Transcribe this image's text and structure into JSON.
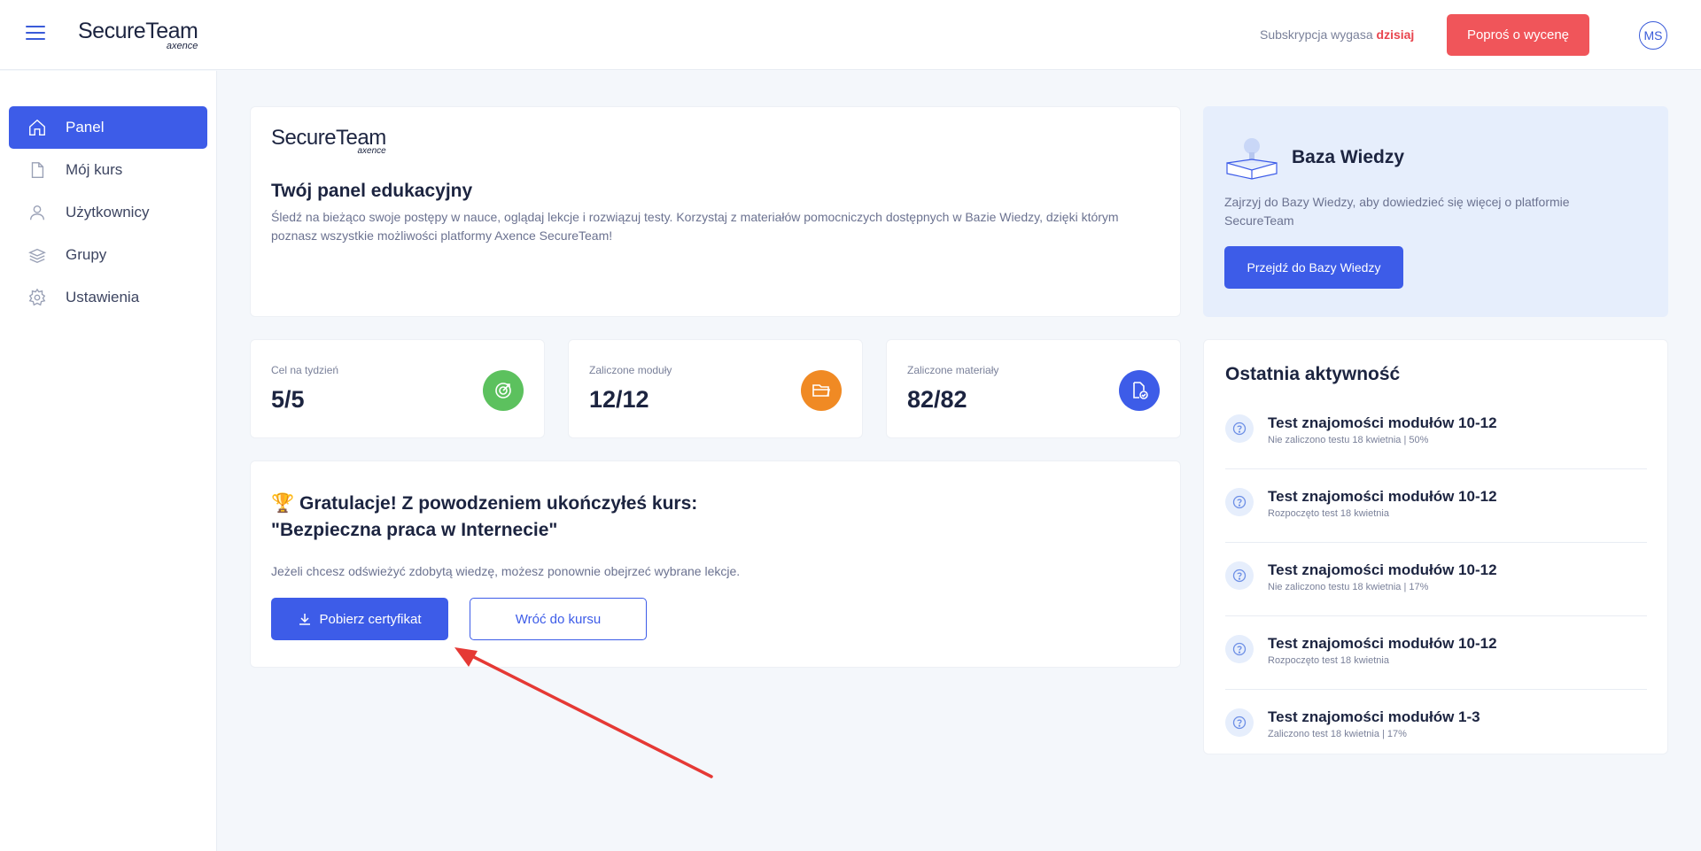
{
  "header": {
    "logo_main": "SecureTeam",
    "logo_sub": "axence",
    "subscription_text": "Subskrypcja wygasa",
    "subscription_highlight": "dzisiaj",
    "quote_button": "Poproś o wycenę",
    "avatar_initials": "MS"
  },
  "sidebar": {
    "items": [
      {
        "label": "Panel",
        "icon": "home-icon",
        "active": true
      },
      {
        "label": "Mój kurs",
        "icon": "document-icon"
      },
      {
        "label": "Użytkownicy",
        "icon": "user-icon"
      },
      {
        "label": "Grupy",
        "icon": "layers-icon"
      },
      {
        "label": "Ustawienia",
        "icon": "gear-icon"
      }
    ]
  },
  "welcome": {
    "title": "Twój panel edukacyjny",
    "description": "Śledź na bieżąco swoje postępy w nauce, oglądaj lekcje i rozwiązuj testy. Korzystaj z materiałów pomocniczych dostępnych w Bazie Wiedzy, dzięki którym poznasz wszystkie możliwości platformy Axence SecureTeam!"
  },
  "knowledge_base": {
    "title": "Baza Wiedzy",
    "description": "Zajrzyj do Bazy Wiedzy, aby dowiedzieć się więcej o platformie SecureTeam",
    "button": "Przejdź do Bazy Wiedzy"
  },
  "stats": [
    {
      "label": "Cel na tydzień",
      "value": "5/5",
      "icon": "target-icon",
      "color": "#5cc15e"
    },
    {
      "label": "Zaliczone moduły",
      "value": "12/12",
      "icon": "folder-icon",
      "color": "#f08a24"
    },
    {
      "label": "Zaliczone materiały",
      "value": "82/82",
      "icon": "file-check-icon",
      "color": "#3d5ce8"
    }
  ],
  "congrats": {
    "emoji": "🏆",
    "title_line1": "Gratulacje! Z powodzeniem ukończyłeś kurs:",
    "title_line2": "\"Bezpieczna praca w Internecie\"",
    "description": "Jeżeli chcesz odświeżyć zdobytą wiedzę, możesz ponownie obejrzeć wybrane lekcje.",
    "cert_button": "Pobierz certyfikat",
    "back_button": "Wróć do kursu"
  },
  "activity": {
    "title": "Ostatnia aktywność",
    "items": [
      {
        "name": "Test znajomości modułów 10-12",
        "sub": "Nie zaliczono testu 18 kwietnia | 50%"
      },
      {
        "name": "Test znajomości modułów 10-12",
        "sub": "Rozpoczęto test 18 kwietnia"
      },
      {
        "name": "Test znajomości modułów 10-12",
        "sub": "Nie zaliczono testu 18 kwietnia | 17%"
      },
      {
        "name": "Test znajomości modułów 10-12",
        "sub": "Rozpoczęto test 18 kwietnia"
      },
      {
        "name": "Test znajomości modułów 1-3",
        "sub": "Zaliczono test 18 kwietnia | 17%"
      }
    ]
  },
  "colors": {
    "accent": "#3d5ce8",
    "quote": "#f0555a",
    "annotation_arrow": "#e53935"
  }
}
